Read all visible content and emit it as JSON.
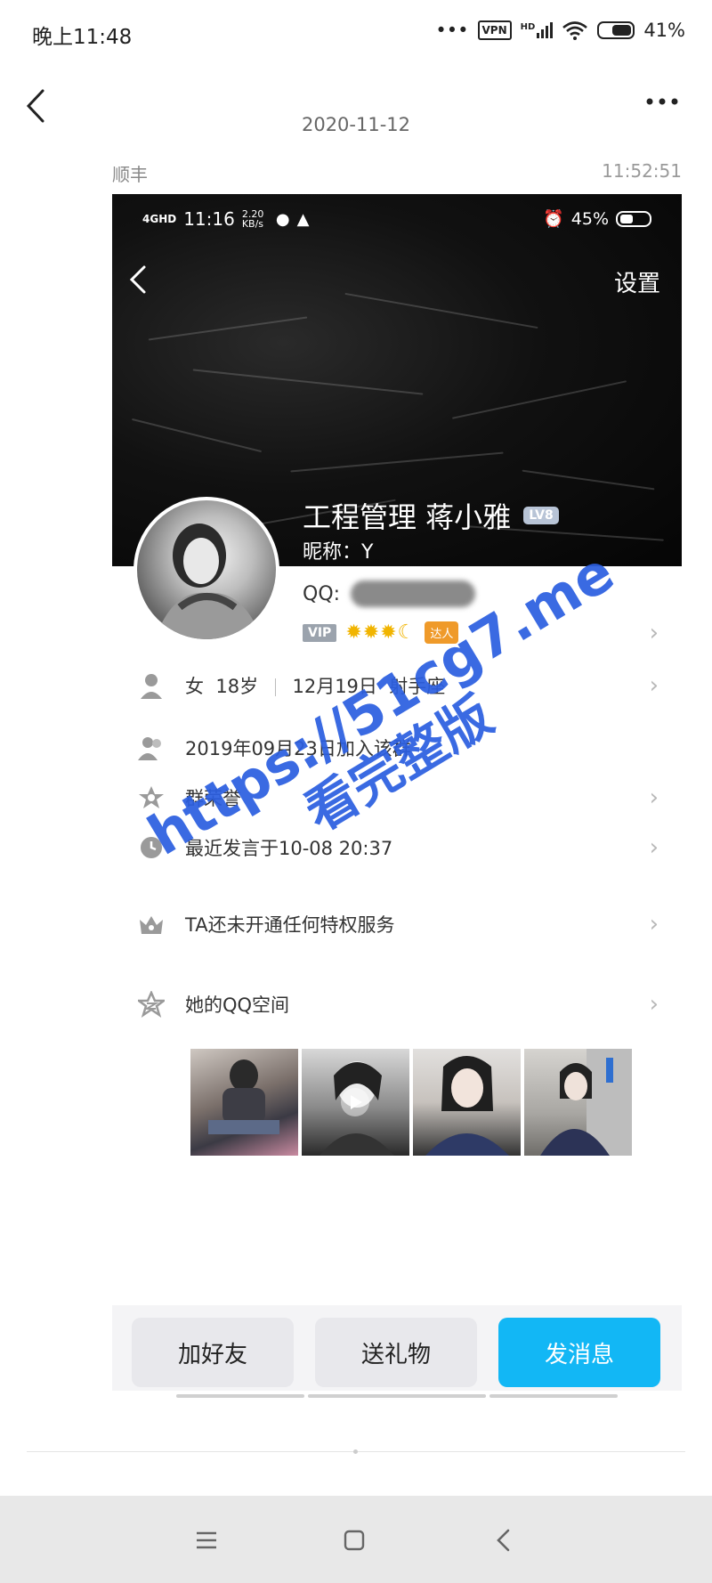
{
  "status_bar": {
    "time": "晚上11:48",
    "dots": "•••",
    "vpn": "VPN",
    "signal": "HD",
    "battery": "41%"
  },
  "chat_header": {
    "date": "2020-11-12"
  },
  "message": {
    "sender": "顺丰",
    "time": "11:52:51"
  },
  "embedded": {
    "status_bar": {
      "net": "4GHD",
      "time": "11:16",
      "speed": "2.20 KB/s",
      "right": "45%"
    },
    "settings_label": "设置",
    "profile": {
      "name": "工程管理 蒋小雅",
      "level": "LV8",
      "nickname": "昵称：Y",
      "qq_label": "QQ:",
      "vip_label": "VIP",
      "badge": "达人"
    },
    "info_rows": [
      {
        "gender": "女",
        "age": "18岁",
        "birthday": "12月19日",
        "zodiac": "射手座"
      },
      {
        "label": "2019年09月23日加入该群"
      },
      {
        "label": "群荣誉"
      },
      {
        "label": "最近发言于10-08 20:37"
      },
      {
        "label": "TA还未开通任何特权服务"
      },
      {
        "label": "她的QQ空间"
      }
    ],
    "actions": {
      "add_friend": "加好友",
      "send_gift": "送礼物",
      "send_message": "发消息"
    }
  },
  "watermark": {
    "line1": "https://51cg7.me",
    "line2": "看完整版"
  },
  "colors": {
    "accent": "#12b7f5",
    "watermark": "#2c5fe0"
  }
}
